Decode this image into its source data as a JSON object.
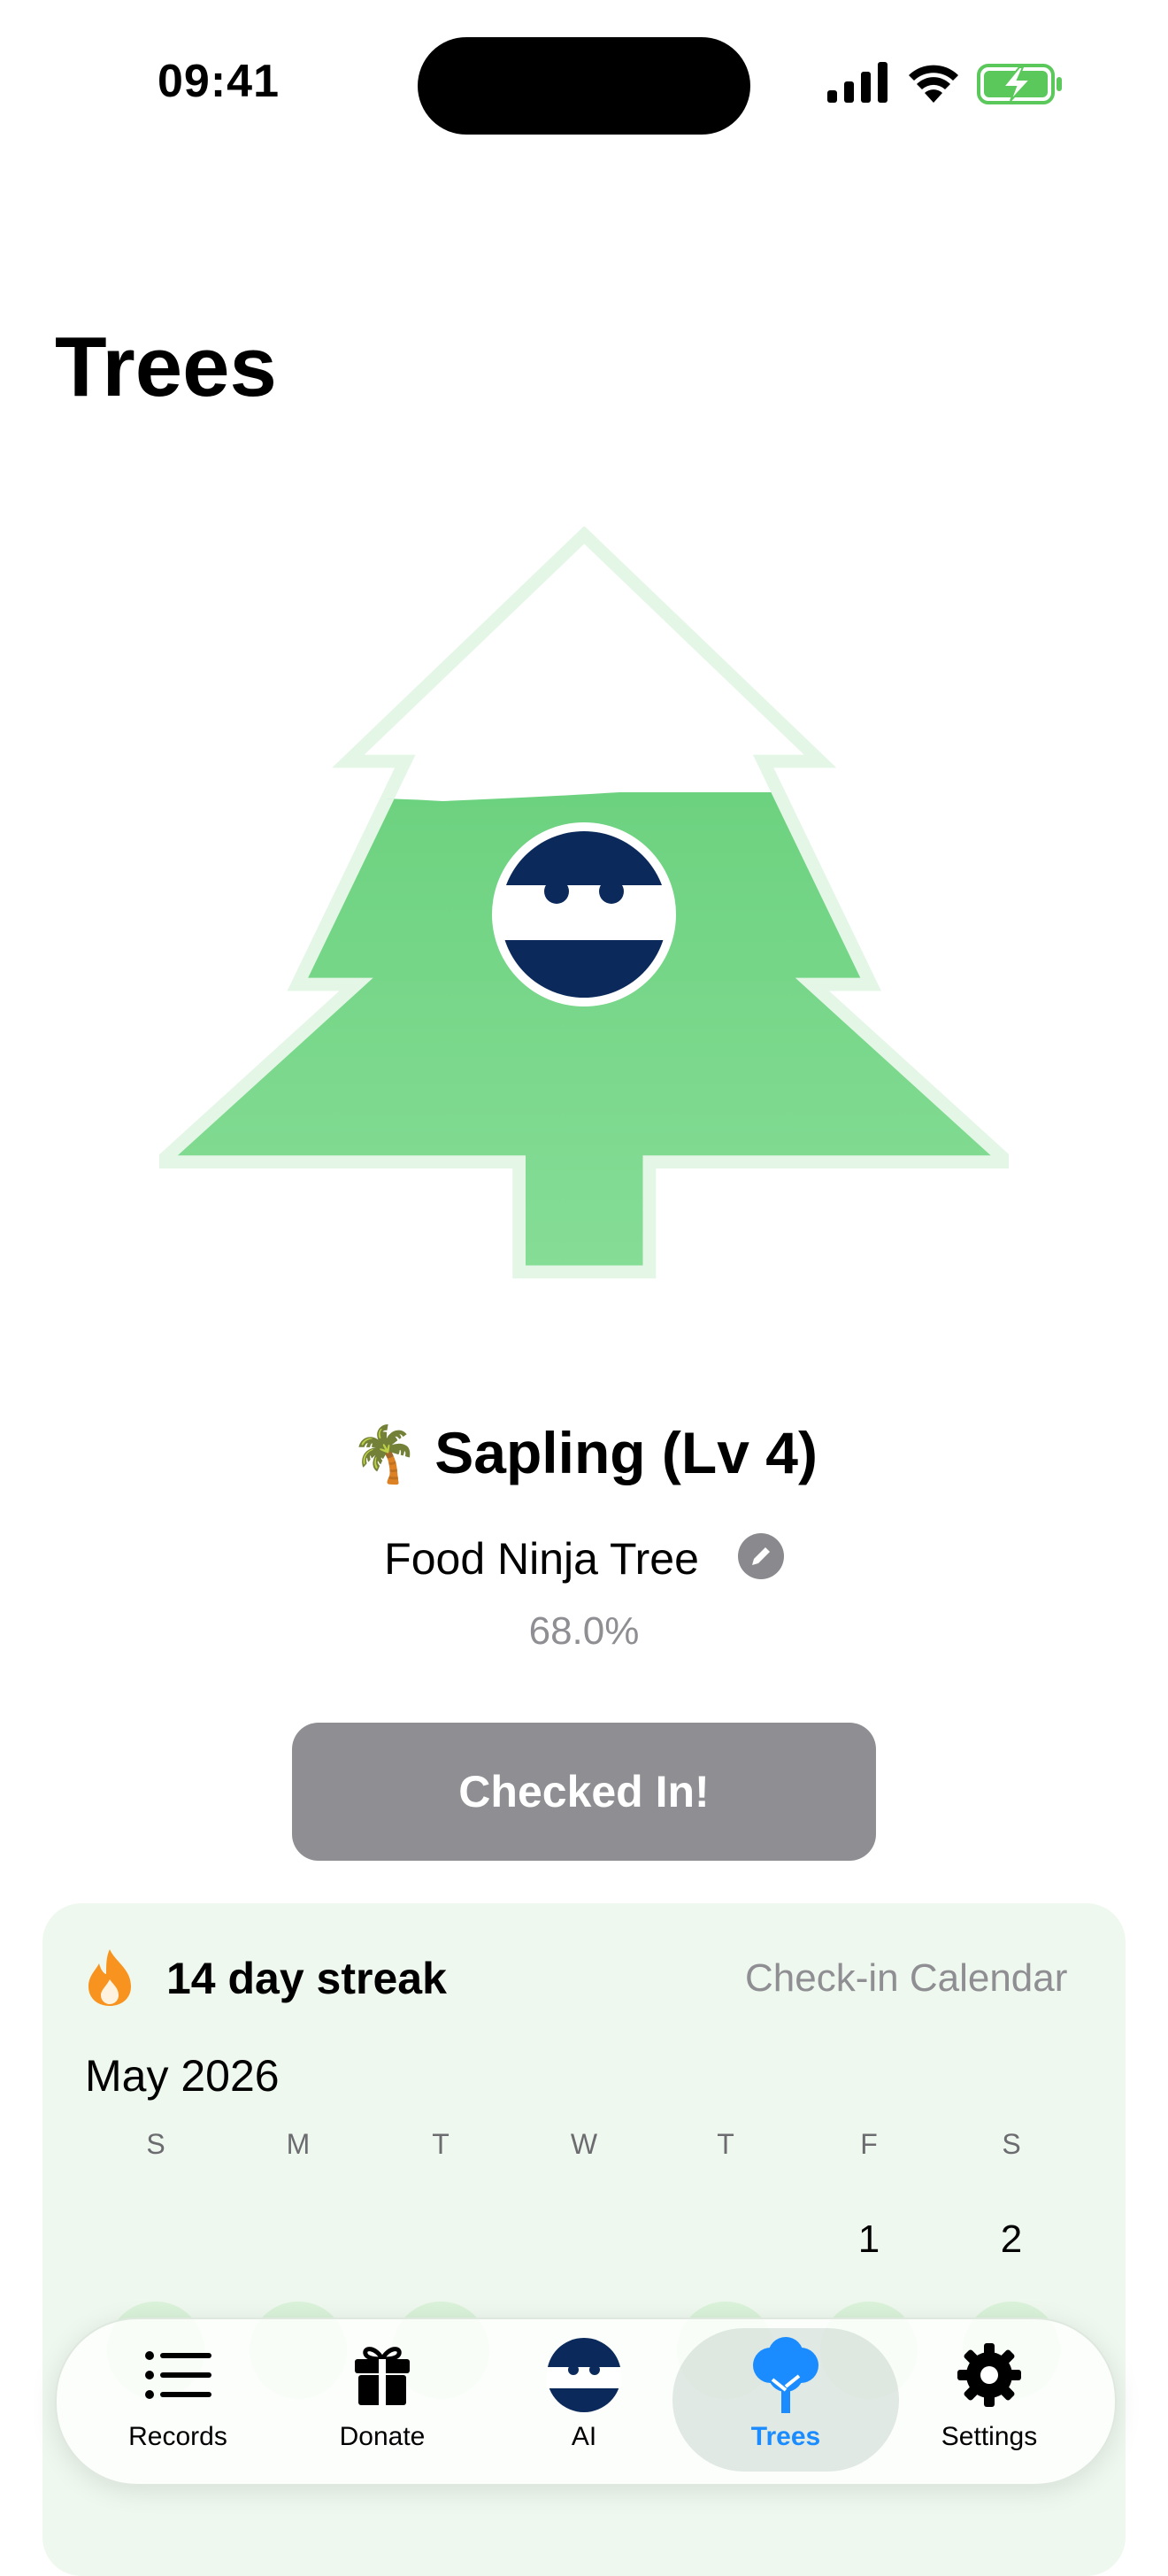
{
  "status_bar": {
    "time": "09:41"
  },
  "page": {
    "title": "Trees"
  },
  "tree": {
    "level_emoji": "🌴",
    "level_label": "Sapling (Lv 4)",
    "name": "Food Ninja Tree",
    "progress_text": "68.0%",
    "progress": 0.68
  },
  "checkin": {
    "label": "Checked In!"
  },
  "streak": {
    "label": "14 day streak",
    "calendar_link": "Check-in Calendar",
    "month": "May 2026",
    "weekdays": [
      "S",
      "M",
      "T",
      "W",
      "T",
      "F",
      "S"
    ],
    "first_row_days": [
      "1",
      "2"
    ]
  },
  "tabs": [
    {
      "label": "Records",
      "icon": "list-icon"
    },
    {
      "label": "Donate",
      "icon": "gift-icon"
    },
    {
      "label": "AI",
      "icon": "ninja-icon"
    },
    {
      "label": "Trees",
      "icon": "tree-icon",
      "active": true
    },
    {
      "label": "Settings",
      "icon": "gear-icon"
    }
  ],
  "colors": {
    "tree_green": "#6dd27f",
    "tree_outline": "#e4f6e6",
    "ninja_navy": "#0b2a5b",
    "accent_blue": "#1a8cff",
    "button_gray": "#8e8e93",
    "card_bg": "#eef8ee",
    "flame_orange": "#f7931e"
  }
}
